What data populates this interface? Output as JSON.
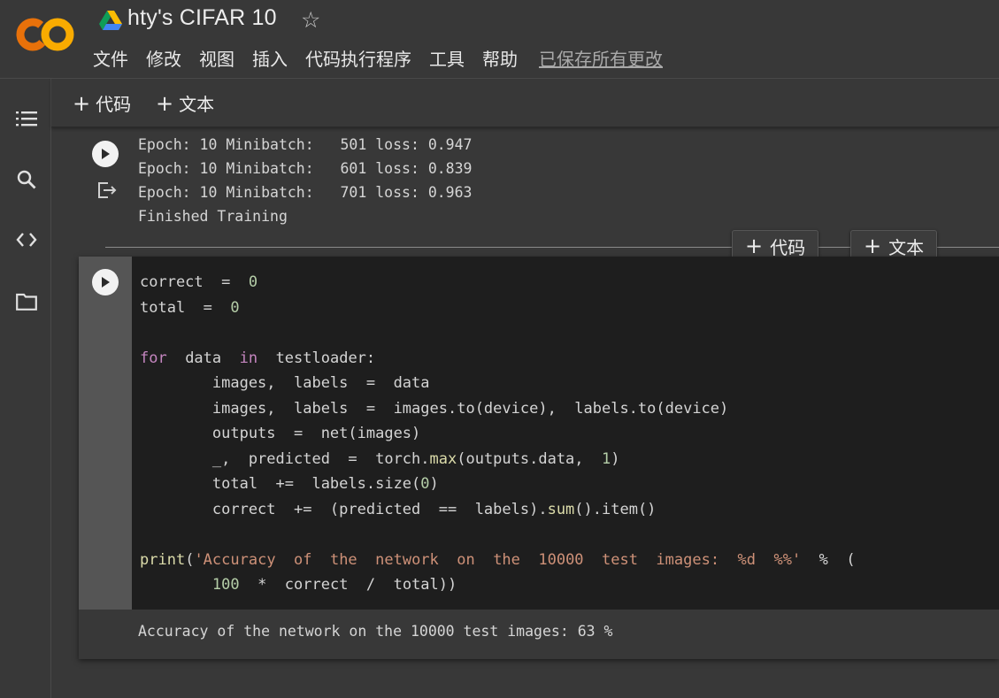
{
  "app": {
    "title": "hty's CIFAR 10",
    "save_status": "已保存所有更改"
  },
  "menu": [
    "文件",
    "修改",
    "视图",
    "插入",
    "代码执行程序",
    "工具",
    "帮助"
  ],
  "toolbar": {
    "add_code": "代码",
    "add_text": "文本"
  },
  "previous_output": {
    "lines": [
      "Epoch: 10 Minibatch:   501 loss: 0.947",
      "Epoch: 10 Minibatch:   601 loss: 0.839",
      "Epoch: 10 Minibatch:   701 loss: 0.963",
      "Finished Training"
    ]
  },
  "insert_buttons": {
    "code": "代码",
    "text": "文本"
  },
  "cell": {
    "code_lines": [
      [
        [
          "v",
          "correct"
        ],
        [
          "op",
          "  =  "
        ],
        [
          "num",
          "0"
        ]
      ],
      [
        [
          "v",
          "total"
        ],
        [
          "op",
          "  =  "
        ],
        [
          "num",
          "0"
        ]
      ],
      [],
      [
        [
          "kw",
          "for"
        ],
        [
          "v",
          "  data  "
        ],
        [
          "kw",
          "in"
        ],
        [
          "v",
          "  testloader:"
        ]
      ],
      [
        [
          "v",
          "        images,  labels  =  data"
        ]
      ],
      [
        [
          "v",
          "        images,  labels  =  images.to(device),  labels.to(device)"
        ]
      ],
      [
        [
          "v",
          "        outputs  =  net(images)"
        ]
      ],
      [
        [
          "v",
          "        _,  predicted  =  torch."
        ],
        [
          "fn",
          "max"
        ],
        [
          "v",
          "(outputs.data,  "
        ],
        [
          "num",
          "1"
        ],
        [
          "v",
          ")"
        ]
      ],
      [
        [
          "v",
          "        total  +=  labels.size("
        ],
        [
          "num",
          "0"
        ],
        [
          "v",
          ")"
        ]
      ],
      [
        [
          "v",
          "        correct  +=  (predicted  ==  labels)."
        ],
        [
          "fn",
          "sum"
        ],
        [
          "v",
          "().item()"
        ]
      ],
      [],
      [
        [
          "fn",
          "print"
        ],
        [
          "v",
          "("
        ],
        [
          "str",
          "'Accuracy  of  the  network  on  the  10000  test  images:  %d  %%'"
        ],
        [
          "v",
          "  %  ("
        ]
      ],
      [
        [
          "v",
          "        "
        ],
        [
          "num",
          "100"
        ],
        [
          "v",
          "  *  correct  /  total))"
        ]
      ]
    ],
    "output": "Accuracy of the network on the 10000 test images: 63 %"
  },
  "colors": {
    "background": "#383838",
    "code_bg": "#1e1e1e",
    "logo_orange": "#f9ab00",
    "logo_dark_orange": "#e8710a"
  }
}
